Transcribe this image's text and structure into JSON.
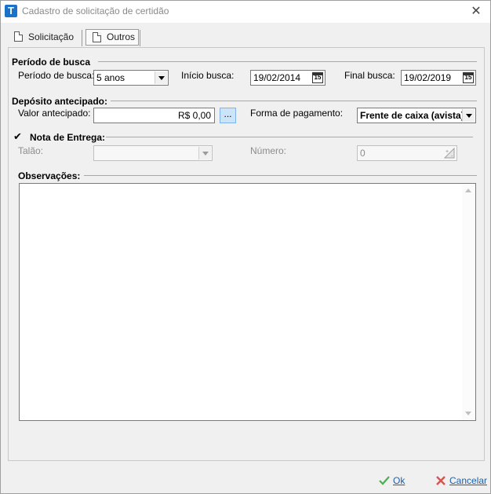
{
  "window": {
    "title": "Cadastro de solicitação de certidão",
    "app_icon_letter": "T",
    "close_glyph": "✕"
  },
  "tabs": [
    {
      "label": "Solicitação",
      "icon": "document-icon"
    },
    {
      "label": "Outros",
      "icon": "document-icon",
      "selected": true
    }
  ],
  "periodo": {
    "section_title": "Período de busca",
    "periodo_label": "Período de busca:",
    "periodo_value": "5 anos",
    "inicio_label": "Início busca:",
    "inicio_value": "19/02/2014",
    "final_label": "Final busca:",
    "final_value": "19/02/2019",
    "calendar_glyph": "15"
  },
  "deposito": {
    "section_title": "Depósito antecipado:",
    "valor_label": "Valor antecipado:",
    "valor_value": "R$ 0,00",
    "ellipsis_label": "...",
    "forma_label": "Forma de pagamento:",
    "forma_value": "Frente de caixa (avista)"
  },
  "nota": {
    "section_title": "Nota de Entrega:",
    "checked_glyph": "✔",
    "checked": true,
    "talao_label": "Talão:",
    "talao_value": "",
    "numero_label": "Número:",
    "numero_value": "0"
  },
  "observacoes": {
    "section_title": "Observações:",
    "value": ""
  },
  "footer": {
    "ok_label": "Ok",
    "cancel_label": "Cancelar"
  },
  "colors": {
    "accent": "#1a73c8",
    "link": "#1d5fa8",
    "ok_icon": "#4caf50",
    "cancel_icon": "#d9534f"
  }
}
